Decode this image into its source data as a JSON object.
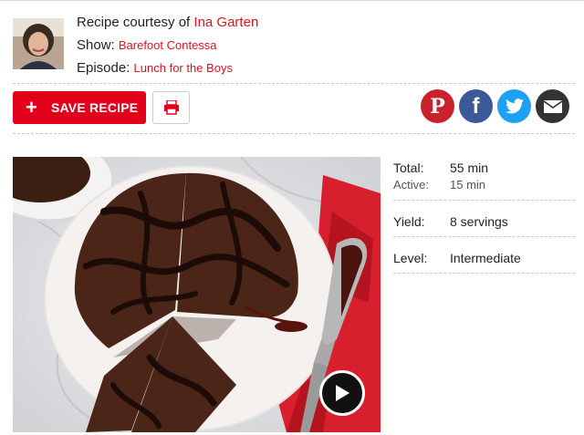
{
  "credit": {
    "prefix": "Recipe courtesy of ",
    "author": "Ina Garten",
    "show_label": "Show: ",
    "show": "Barefoot Contessa",
    "episode_label": "Episode: ",
    "episode": "Lunch for the Boys"
  },
  "actions": {
    "save_label": "SAVE RECIPE",
    "save_icon": "plus-icon",
    "print_icon": "printer-icon"
  },
  "social": [
    {
      "name": "pinterest",
      "glyph": "P",
      "color": "#c8232c"
    },
    {
      "name": "facebook",
      "glyph": "f",
      "color": "#3b5998"
    },
    {
      "name": "twitter",
      "glyph": "bird",
      "color": "#1da1f2"
    },
    {
      "name": "email",
      "glyph": "envelope",
      "color": "#333333"
    }
  ],
  "recipe_info": {
    "total_label": "Total:",
    "total": "55 min",
    "active_label": "Active:",
    "active": "15 min",
    "yield_label": "Yield:",
    "yield": "8 servings",
    "level_label": "Level:",
    "level": "Intermediate"
  },
  "media": {
    "play_icon": "play-icon"
  },
  "colors": {
    "brand_red": "#e3001b",
    "link_red": "#d9141d"
  }
}
